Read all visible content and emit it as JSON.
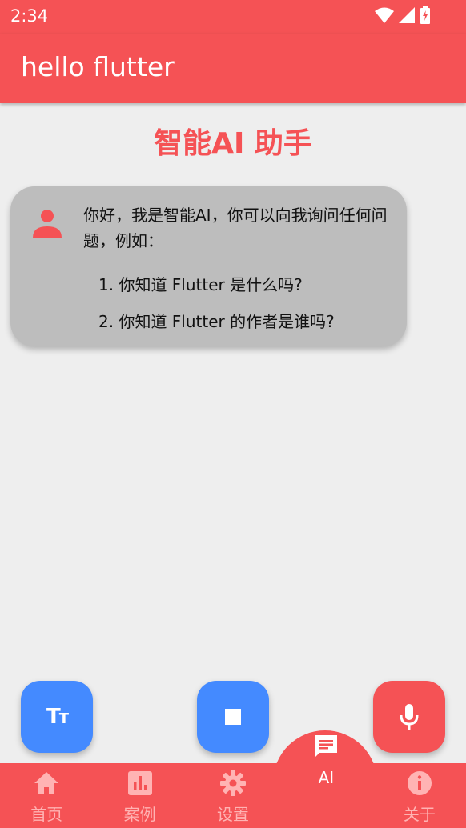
{
  "status_bar": {
    "time": "2:34"
  },
  "app_bar": {
    "title": "hello flutter"
  },
  "page": {
    "heading": "智能AI 助手"
  },
  "chat": {
    "intro": "你好，我是智能AI，你可以向我询问任何问题，例如：",
    "examples": [
      "1. 你知道 Flutter 是什么吗?",
      "2. 你知道 Flutter 的作者是谁吗?"
    ]
  },
  "fabs": {
    "text_icon": "text-size-icon",
    "stop_icon": "stop-icon",
    "mic_icon": "microphone-icon"
  },
  "bottom_nav": {
    "items": [
      {
        "label": "首页",
        "icon": "home-icon"
      },
      {
        "label": "案例",
        "icon": "bar-chart-icon"
      },
      {
        "label": "设置",
        "icon": "gear-icon"
      },
      {
        "label": "AI",
        "icon": "chat-icon"
      },
      {
        "label": "关于",
        "icon": "info-icon"
      }
    ],
    "active_index": 3
  },
  "colors": {
    "primary": "#f55255",
    "fab_blue": "#448aff",
    "bubble": "#bdbdbd",
    "background": "#eeeeee"
  }
}
